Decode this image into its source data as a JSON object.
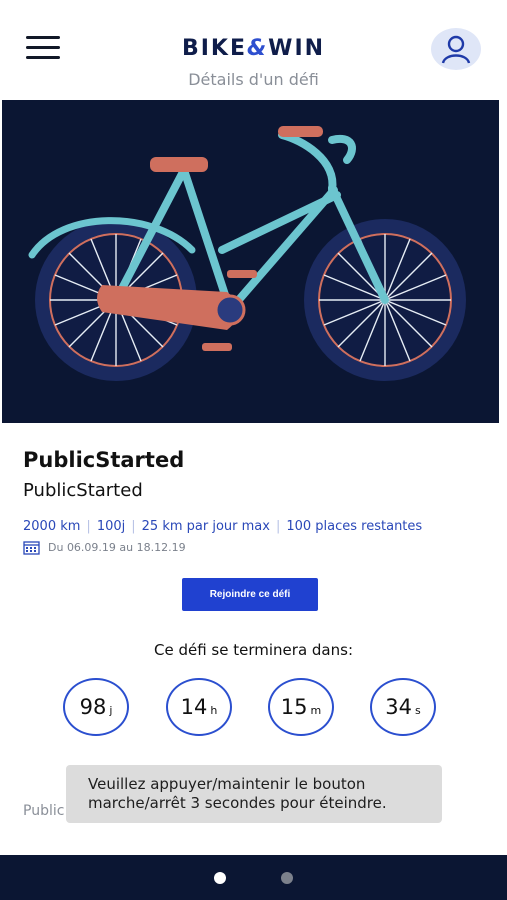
{
  "header": {
    "logo_left": "BIKE",
    "logo_amp": "&",
    "logo_right": "WIN",
    "subtitle": "Détails d'un défi"
  },
  "challenge": {
    "title": "PublicStarted",
    "subtitle": "PublicStarted",
    "distance": "2000 km",
    "duration": "100j",
    "daily_max": "25 km par jour max",
    "places": "100 places restantes",
    "dates": "Du 06.09.19 au 18.12.19"
  },
  "actions": {
    "join_label": "Rejoindre ce défi"
  },
  "countdown": {
    "label": "Ce défi se terminera dans:",
    "days": "98",
    "days_unit": "j",
    "hours": "14",
    "hours_unit": "h",
    "minutes": "15",
    "minutes_unit": "m",
    "seconds": "34",
    "seconds_unit": "s"
  },
  "background_text": "Public",
  "toast": {
    "line1": "Veuillez appuyer/maintenir le bouton",
    "line2": "marche/arrêt 3 secondes pour éteindre."
  },
  "colors": {
    "accent": "#2041d0",
    "navy": "#0b1633",
    "bike_frame": "#6cc5cf",
    "bike_accent": "#cf6f5e"
  },
  "icons": {
    "menu": "hamburger-icon",
    "profile": "user-icon",
    "calendar": "calendar-icon"
  }
}
